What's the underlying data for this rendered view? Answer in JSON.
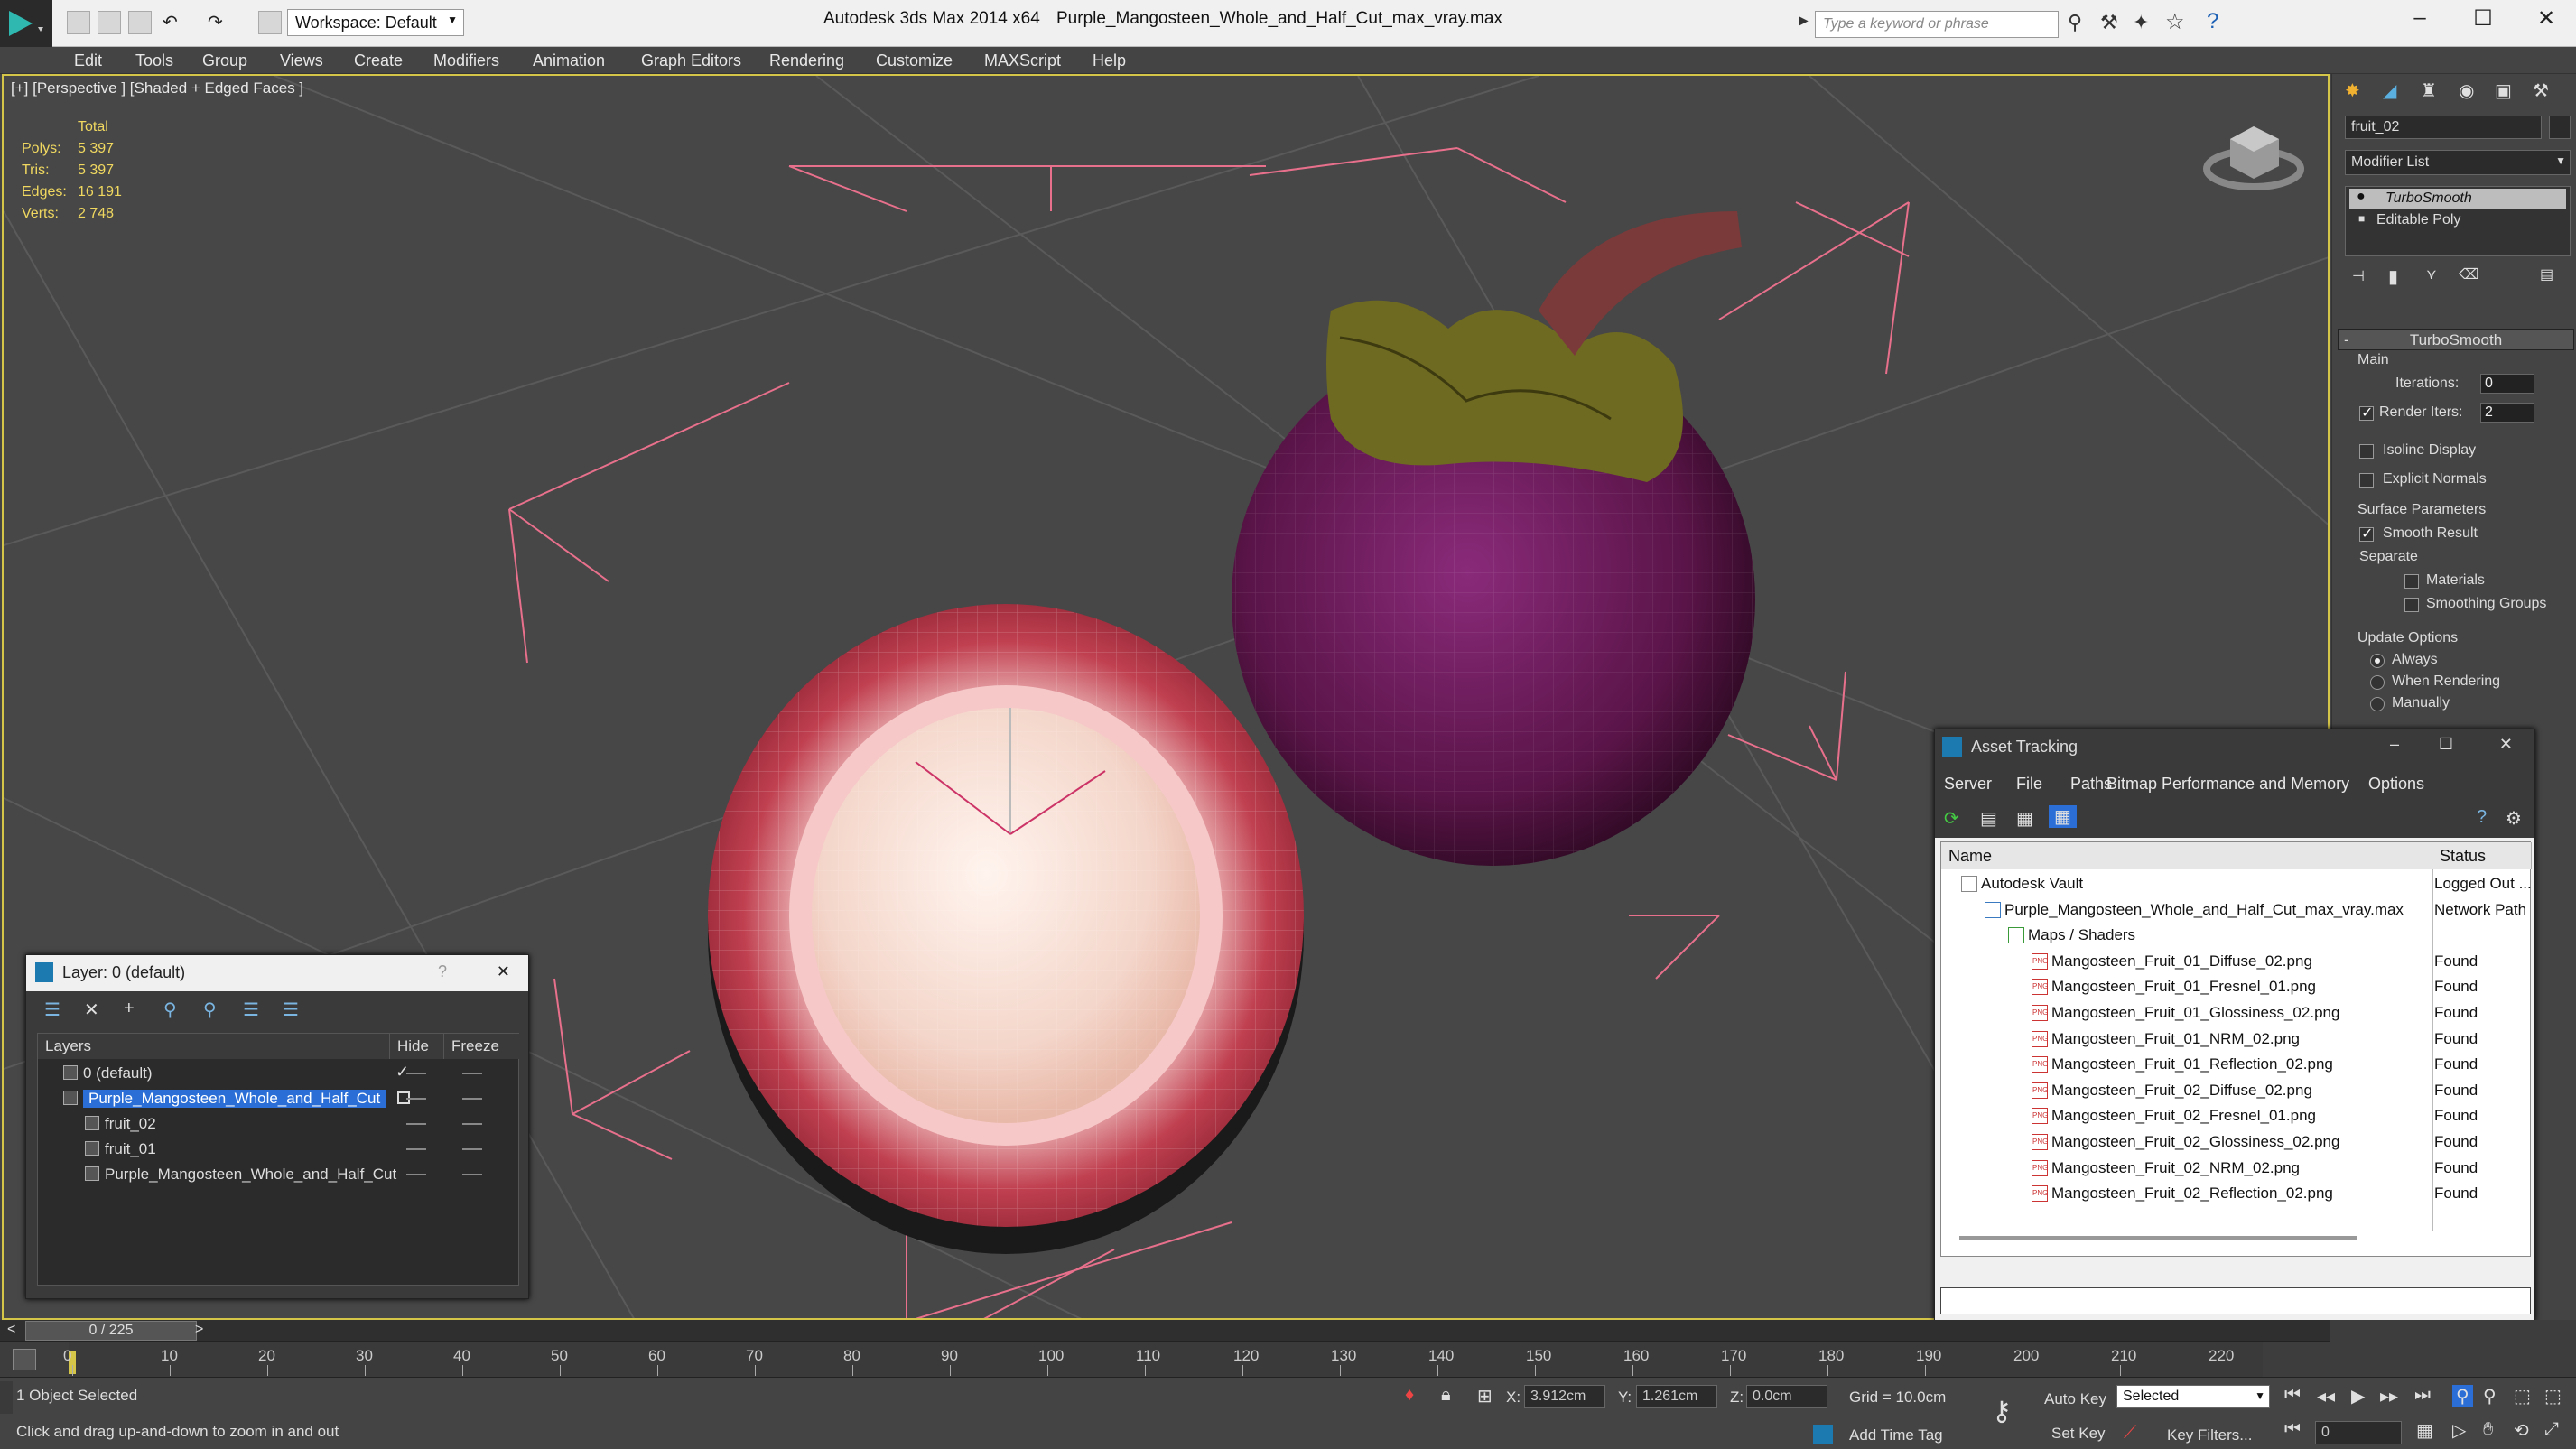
{
  "titlebar": {
    "app": "Autodesk 3ds Max  2014 x64",
    "file": "Purple_Mangosteen_Whole_and_Half_Cut_max_vray.max",
    "workspace": "Workspace: Default",
    "search_placeholder": "Type a keyword or phrase",
    "minimize": "–",
    "maximize": "☐",
    "close": "✕"
  },
  "menu": [
    "Edit",
    "Tools",
    "Group",
    "Views",
    "Create",
    "Modifiers",
    "Animation",
    "Graph Editors",
    "Rendering",
    "Customize",
    "MAXScript",
    "Help"
  ],
  "viewport": {
    "label": "[+] [Perspective ] [Shaded + Edged Faces ]",
    "stats": {
      "header": "Total",
      "rows": [
        {
          "label": "Polys:",
          "value": "5 397"
        },
        {
          "label": "Tris:",
          "value": "5 397"
        },
        {
          "label": "Edges:",
          "value": "16 191"
        },
        {
          "label": "Verts:",
          "value": "2 748"
        }
      ]
    }
  },
  "command_panel": {
    "object_name": "fruit_02",
    "modifier_list": "Modifier List",
    "stack": [
      "TurboSmooth",
      "Editable Poly"
    ],
    "rollout_title": "TurboSmooth",
    "main_label": "Main",
    "iterations_label": "Iterations:",
    "iterations_value": "0",
    "render_iters_label": "Render Iters:",
    "render_iters_value": "2",
    "isoline": "Isoline Display",
    "explicit": "Explicit Normals",
    "surface_params": "Surface Parameters",
    "smooth_result": "Smooth Result",
    "separate": "Separate",
    "materials": "Materials",
    "smoothing_groups": "Smoothing Groups",
    "update_options": "Update Options",
    "always": "Always",
    "when_rendering": "When Rendering",
    "manually": "Manually",
    "collapse": "-"
  },
  "layer_panel": {
    "title": "Layer: 0 (default)",
    "help": "?",
    "close": "✕",
    "col_layers": "Layers",
    "col_hide": "Hide",
    "col_freeze": "Freeze",
    "rows": [
      {
        "name": "0 (default)",
        "indent": 0,
        "active": true,
        "selected": false
      },
      {
        "name": "Purple_Mangosteen_Whole_and_Half_Cut",
        "indent": 0,
        "active": false,
        "selected": true
      },
      {
        "name": "fruit_02",
        "indent": 1,
        "active": false,
        "selected": false
      },
      {
        "name": "fruit_01",
        "indent": 1,
        "active": false,
        "selected": false
      },
      {
        "name": "Purple_Mangosteen_Whole_and_Half_Cut",
        "indent": 1,
        "active": false,
        "selected": false
      }
    ]
  },
  "asset_panel": {
    "title": "Asset Tracking",
    "minimize": "–",
    "maximize": "☐",
    "close": "✕",
    "menu": [
      "Server",
      "File",
      "Paths",
      "Bitmap Performance and Memory",
      "Options"
    ],
    "col_name": "Name",
    "col_status": "Status",
    "rows": [
      {
        "name": "Autodesk Vault",
        "status": "Logged Out ...",
        "indent": 1,
        "kind": "vault"
      },
      {
        "name": "Purple_Mangosteen_Whole_and_Half_Cut_max_vray.max",
        "status": "Network Path",
        "indent": 2,
        "kind": "max"
      },
      {
        "name": "Maps / Shaders",
        "status": "",
        "indent": 3,
        "kind": "maps"
      },
      {
        "name": "Mangosteen_Fruit_01_Diffuse_02.png",
        "status": "Found",
        "indent": 4,
        "kind": "png"
      },
      {
        "name": "Mangosteen_Fruit_01_Fresnel_01.png",
        "status": "Found",
        "indent": 4,
        "kind": "png"
      },
      {
        "name": "Mangosteen_Fruit_01_Glossiness_02.png",
        "status": "Found",
        "indent": 4,
        "kind": "png"
      },
      {
        "name": "Mangosteen_Fruit_01_NRM_02.png",
        "status": "Found",
        "indent": 4,
        "kind": "png"
      },
      {
        "name": "Mangosteen_Fruit_01_Reflection_02.png",
        "status": "Found",
        "indent": 4,
        "kind": "png"
      },
      {
        "name": "Mangosteen_Fruit_02_Diffuse_02.png",
        "status": "Found",
        "indent": 4,
        "kind": "png"
      },
      {
        "name": "Mangosteen_Fruit_02_Fresnel_01.png",
        "status": "Found",
        "indent": 4,
        "kind": "png"
      },
      {
        "name": "Mangosteen_Fruit_02_Glossiness_02.png",
        "status": "Found",
        "indent": 4,
        "kind": "png"
      },
      {
        "name": "Mangosteen_Fruit_02_NRM_02.png",
        "status": "Found",
        "indent": 4,
        "kind": "png"
      },
      {
        "name": "Mangosteen_Fruit_02_Reflection_02.png",
        "status": "Found",
        "indent": 4,
        "kind": "png"
      }
    ]
  },
  "timeline": {
    "frame": "0 / 225",
    "prev": "<",
    "next": ">",
    "ticks": [
      "0",
      "10",
      "20",
      "30",
      "40",
      "50",
      "60",
      "70",
      "80",
      "90",
      "100",
      "110",
      "120",
      "130",
      "140",
      "150",
      "160",
      "170",
      "180",
      "190",
      "200",
      "210",
      "220"
    ]
  },
  "status": {
    "selected": "1 Object Selected",
    "prompt": "Click and drag up-and-down to zoom in and out",
    "x_label": "X:",
    "x_value": "3.912cm",
    "y_label": "Y:",
    "y_value": "1.261cm",
    "z_label": "Z:",
    "z_value": "0.0cm",
    "grid": "Grid = 10.0cm",
    "auto_key": "Auto Key",
    "set_key": "Set Key",
    "selected_dropdown": "Selected",
    "key_filters": "Key Filters...",
    "add_time_tag": "Add Time Tag",
    "current_frame": "0"
  },
  "colors": {
    "viewport_border": "#d4c448",
    "stats_text": "#f0d860",
    "selection": "#2b6fd6",
    "bbox_lines": "#e8708c"
  }
}
